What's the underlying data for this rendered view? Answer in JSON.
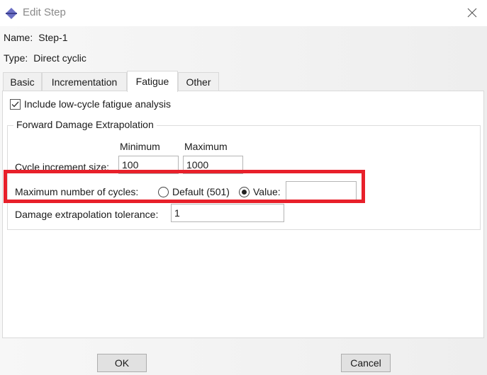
{
  "window": {
    "title": "Edit Step",
    "icon": "step-diamond-icon",
    "close_icon": "close-icon"
  },
  "step": {
    "name_label": "Name:",
    "name_value": "Step-1",
    "type_label": "Type:",
    "type_value": "Direct cyclic"
  },
  "tabs": [
    {
      "label": "Basic",
      "active": false
    },
    {
      "label": "Incrementation",
      "active": false
    },
    {
      "label": "Fatigue",
      "active": true
    },
    {
      "label": "Other",
      "active": false
    }
  ],
  "fatigue": {
    "low_cycle_checkbox": {
      "label": "Include low-cycle fatigue analysis",
      "checked": true
    },
    "group_title": "Forward Damage Extrapolation",
    "columns": {
      "minimum": "Minimum",
      "maximum": "Maximum"
    },
    "cycle_increment": {
      "label": "Cycle increment size:",
      "minimum": "100",
      "maximum": "1000"
    },
    "max_cycles": {
      "label": "Maximum number of cycles:",
      "options": [
        {
          "label": "Default (501)",
          "selected": false
        },
        {
          "label": "Value:",
          "selected": true
        }
      ],
      "value": ""
    },
    "damage_tolerance": {
      "label": "Damage extrapolation tolerance:",
      "value": "1"
    }
  },
  "annotation": {
    "highlight_color": "#e8202a",
    "target": "max-cycles-row"
  },
  "buttons": {
    "ok": "OK",
    "cancel": "Cancel"
  }
}
